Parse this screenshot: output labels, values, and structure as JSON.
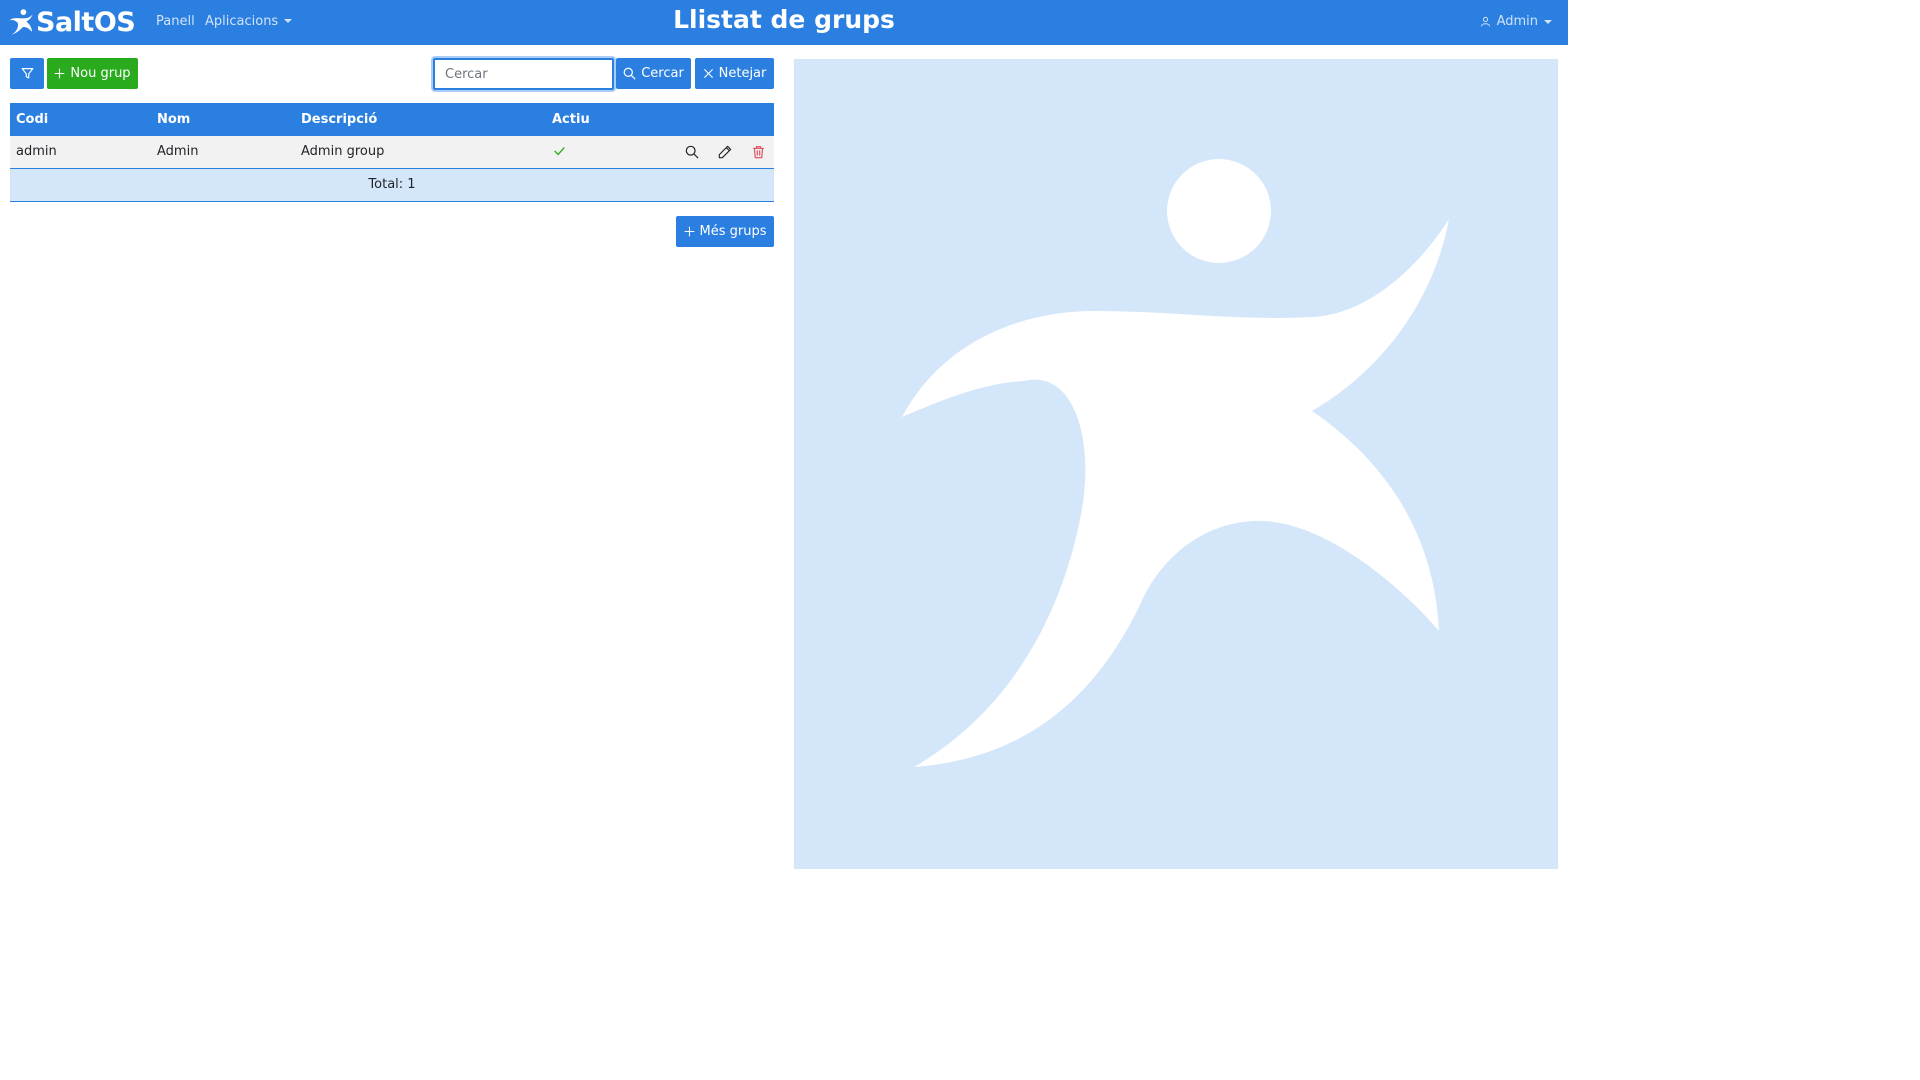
{
  "navbar": {
    "brand": "SaltOS",
    "links": [
      {
        "label": "Panell"
      },
      {
        "label": "Aplicacions"
      }
    ],
    "title": "Llistat de grups",
    "user": "Admin"
  },
  "toolbar": {
    "filter_icon": "funnel-icon",
    "new_label": "Nou grup",
    "search_placeholder": "Cercar",
    "search_value": "",
    "search_label": "Cercar",
    "clear_label": "Netejar"
  },
  "table": {
    "columns": [
      "Codi",
      "Nom",
      "Descripció",
      "Actiu"
    ],
    "rows": [
      {
        "code": "admin",
        "name": "Admin",
        "description": "Admin group",
        "active": true
      }
    ],
    "footer": "Total: 1"
  },
  "more_label": "Més grups",
  "colors": {
    "primary": "#2a7fe0",
    "success": "#2aab1e",
    "danger": "#e04b5a",
    "panel": "#d4e6fa"
  }
}
